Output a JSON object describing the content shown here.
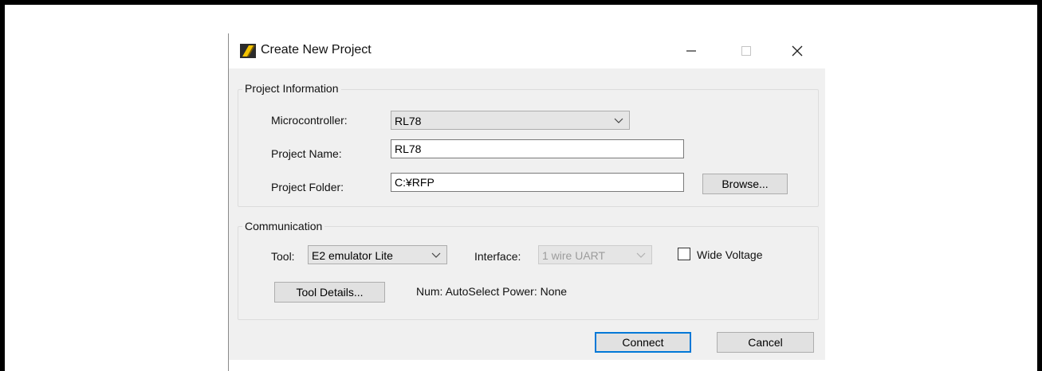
{
  "window": {
    "title": "Create New Project",
    "controls": {
      "minimize": "minimize-icon",
      "maximize": "maximize-icon",
      "close": "close-icon"
    }
  },
  "project_info": {
    "group_label": "Project Information",
    "microcontroller": {
      "label": "Microcontroller:",
      "value": "RL78"
    },
    "project_name": {
      "label": "Project Name:",
      "value": "RL78"
    },
    "project_folder": {
      "label": "Project Folder:",
      "value": "C:¥RFP"
    },
    "browse_label": "Browse..."
  },
  "communication": {
    "group_label": "Communication",
    "tool": {
      "label": "Tool:",
      "value": "E2 emulator Lite"
    },
    "interface": {
      "label": "Interface:",
      "value": "1 wire UART"
    },
    "wide_voltage": {
      "label": "Wide Voltage",
      "checked": false
    },
    "tool_details_label": "Tool Details...",
    "status": "Num: AutoSelect  Power: None"
  },
  "footer": {
    "connect_label": "Connect",
    "cancel_label": "Cancel"
  },
  "colors": {
    "dialog_bg": "#f0f0f0",
    "accent": "#0078d7",
    "disabled_text": "#9c9c9c"
  }
}
